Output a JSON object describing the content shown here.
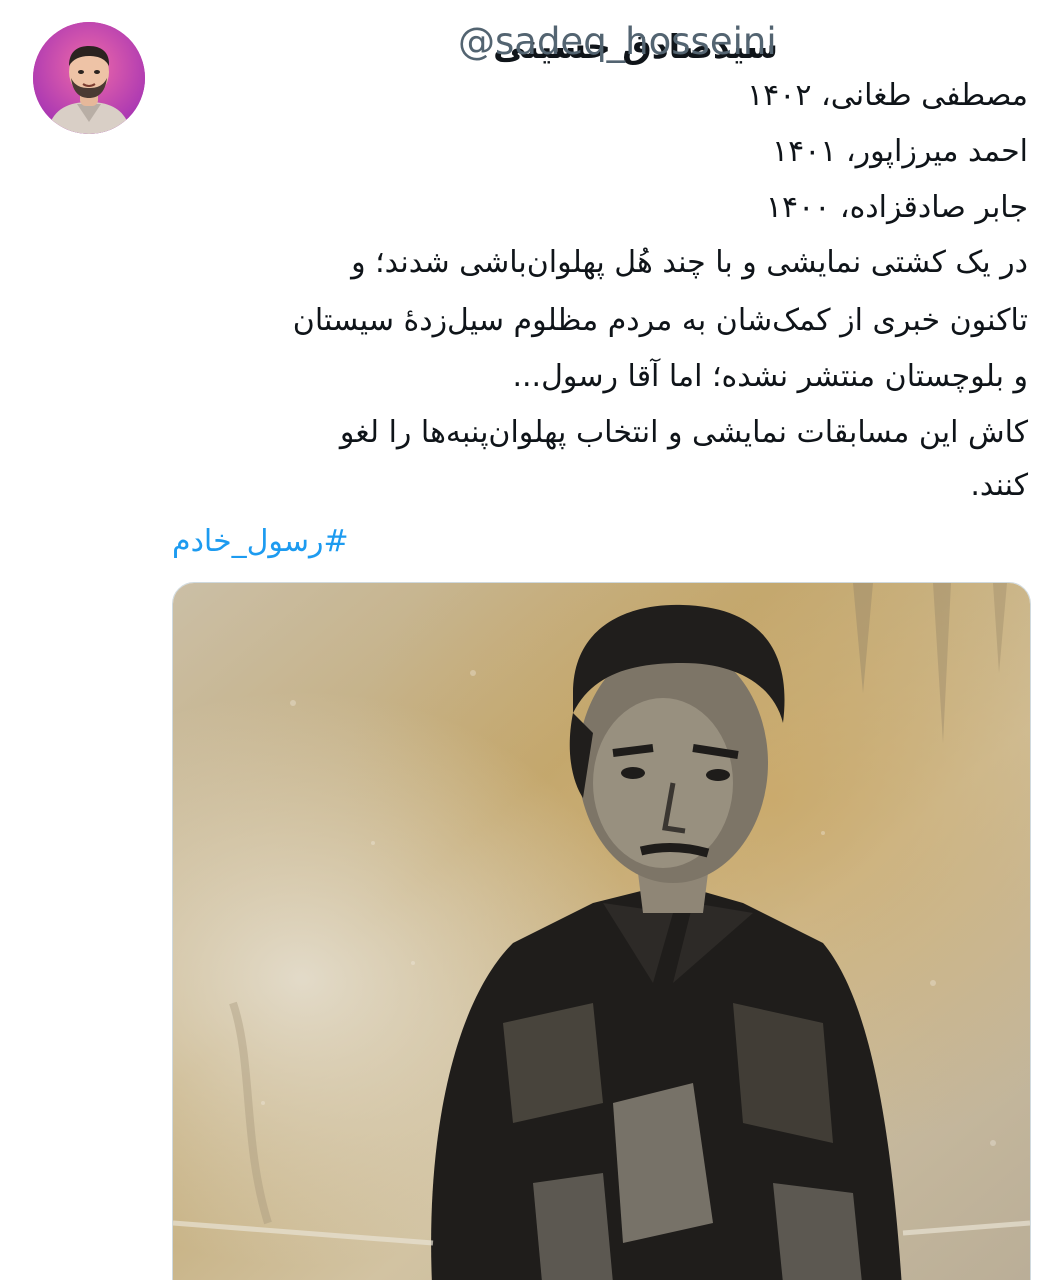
{
  "author": {
    "display_name": "سیدصادق حسینی",
    "handle": "@sadeq_hosseini"
  },
  "tweet": {
    "lines": [
      "مصطفی طغانی، ۱۴۰۲",
      "احمد میرزاپور، ۱۴۰۱",
      "جابر صادقزاده، ۱۴۰۰",
      "در یک کشتی نمایشی و با چند هُل پهلوان‌باشی شدند؛ و",
      "تاکنون خبری از کمک‌شان به مردم مظلوم سیل‌زدهٔ سیستان",
      "و بلوچستان منتشر نشده؛ اما آقا رسول...",
      "کاش این مسابقات نمایشی و انتخاب پهلوان‌پنبه‌ها را لغو",
      "کنند."
    ],
    "hashtag": "#رسول_خادم"
  },
  "colors": {
    "text": "#0f1419",
    "secondary": "#536471",
    "link": "#1d9bf0",
    "avatar_bg": "#c13ba8"
  },
  "icons": {
    "avatar": "user-avatar",
    "media": "wrestler-portrait-photo"
  }
}
